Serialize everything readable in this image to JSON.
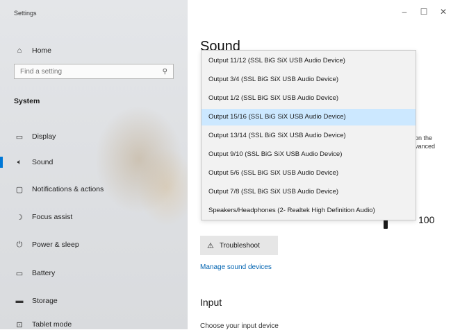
{
  "window": {
    "title": "Settings",
    "controls": {
      "minimize": "–",
      "maximize": "☐",
      "close": "✕"
    }
  },
  "sidebar": {
    "home": "Home",
    "search_placeholder": "Find a setting",
    "section": "System",
    "items": [
      {
        "label": "Display",
        "icon": "display-icon"
      },
      {
        "label": "Sound",
        "icon": "sound-icon",
        "selected": true
      },
      {
        "label": "Notifications & actions",
        "icon": "notifications-icon"
      },
      {
        "label": "Focus assist",
        "icon": "focus-assist-icon"
      },
      {
        "label": "Power & sleep",
        "icon": "power-icon"
      },
      {
        "label": "Battery",
        "icon": "battery-icon"
      },
      {
        "label": "Storage",
        "icon": "storage-icon"
      },
      {
        "label": "Tablet mode",
        "icon": "tablet-icon"
      }
    ]
  },
  "main": {
    "title": "Sound",
    "side_text_line1": "on the",
    "side_text_line2": "vanced",
    "volume": "100",
    "troubleshoot": "Troubleshoot",
    "manage_link": "Manage sound devices",
    "input_heading": "Input",
    "choose_input": "Choose your input device"
  },
  "dropdown": {
    "options": [
      "Output 11/12 (SSL BiG SiX USB Audio Device)",
      "Output 3/4 (SSL BiG SiX USB Audio Device)",
      "Output 1/2 (SSL BiG SiX USB Audio Device)",
      "Output 15/16 (SSL BiG SiX USB Audio Device)",
      "Output 13/14 (SSL BiG SiX USB Audio Device)",
      "Output 9/10 (SSL BiG SiX USB Audio Device)",
      "Output 5/6 (SSL BiG SiX USB Audio Device)",
      "Output 7/8 (SSL BiG SiX USB Audio Device)",
      "Speakers/Headphones (2- Realtek High Definition Audio)"
    ],
    "selected_index": 3
  },
  "colors": {
    "accent": "#0078d7",
    "link": "#0063b1",
    "selected_option": "#cce8ff"
  }
}
